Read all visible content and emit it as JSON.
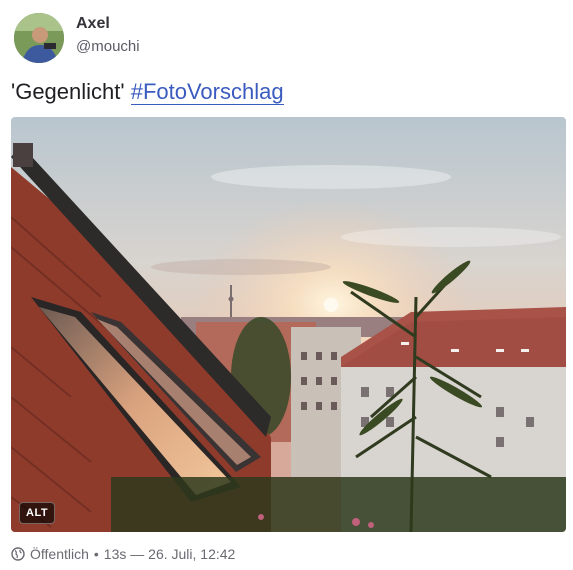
{
  "author": {
    "display_name": "Axel",
    "handle": "@mouchi"
  },
  "status": {
    "text_prefix": "'Gegenlicht' ",
    "hashtag": "#FotoVorschlag"
  },
  "media": {
    "alt_badge": "ALT",
    "icon": "photo"
  },
  "meta": {
    "visibility_icon": "globe-icon",
    "visibility": "Öffentlich",
    "separator": "•",
    "relative_time": "13s",
    "dash": "—",
    "timestamp": "26. Juli, 12:42"
  },
  "colors": {
    "hashtag": "#3a5bbf",
    "meta_text": "#6a6a72"
  }
}
